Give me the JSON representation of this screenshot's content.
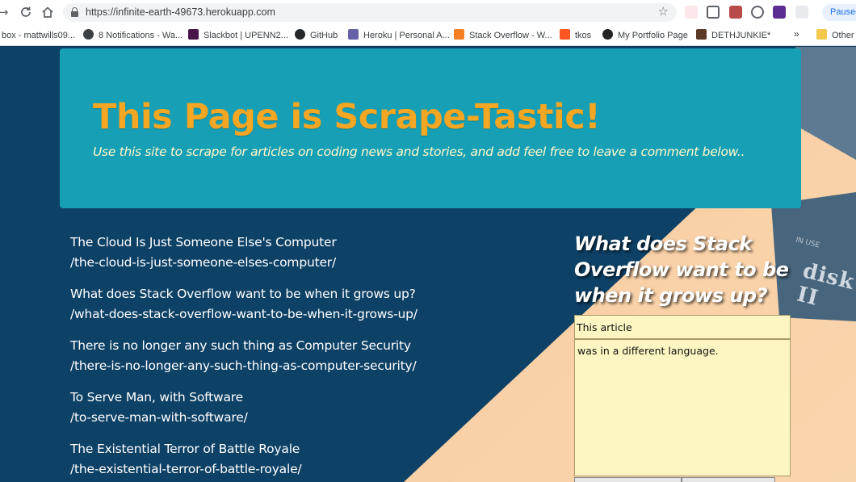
{
  "browser": {
    "url": "https://infinite-earth-49673.herokuapp.com",
    "paused_label": "Paused",
    "bookmarks": [
      {
        "label": "box - mattwills09...",
        "color": "#d93025"
      },
      {
        "label": "8 Notifications - Wa...",
        "color": "#3c4043"
      },
      {
        "label": "Slackbot | UPENN2...",
        "color": "#4a154b"
      },
      {
        "label": "GitHub",
        "color": "#24292e"
      },
      {
        "label": "Heroku | Personal A...",
        "color": "#6762a6"
      },
      {
        "label": "Stack Overflow - W...",
        "color": "#f48024"
      },
      {
        "label": "tkos",
        "color": "#ff5722"
      },
      {
        "label": "My Portfolio Page",
        "color": "#222222"
      },
      {
        "label": "DETHJUNKIE*",
        "color": "#5b3a29"
      }
    ],
    "other_bookmarks": "Other"
  },
  "header": {
    "title": "This Page is Scrape-Tastic!",
    "subtitle": "Use this site to scrape for articles on coding news and stories, and add feel free to leave a comment below.."
  },
  "articles": [
    {
      "title": "The Cloud Is Just Someone Else's Computer",
      "link": "/the-cloud-is-just-someone-elses-computer/"
    },
    {
      "title": "What does Stack Overflow want to be when it grows up?",
      "link": "/what-does-stack-overflow-want-to-be-when-it-grows-up/"
    },
    {
      "title": "There is no longer any such thing as Computer Security",
      "link": "/there-is-no-longer-any-such-thing-as-computer-security/"
    },
    {
      "title": "To Serve Man, with Software",
      "link": "/to-serve-man-with-software/"
    },
    {
      "title": "The Existential Terror of Battle Royale",
      "link": "/the-existential-terror-of-battle-royale/"
    }
  ],
  "notes": {
    "heading": "What does Stack Overflow want to be when it grows up?",
    "title_value": "This article",
    "body_value": "was in a different language."
  },
  "background_art": {
    "disk_label": "disk II",
    "disk_small": "IN USE"
  },
  "colors": {
    "page_bg": "#0e4166",
    "jumbotron": "#17a0b5",
    "title": "#f5a623",
    "note_field": "#fdf6c3"
  }
}
